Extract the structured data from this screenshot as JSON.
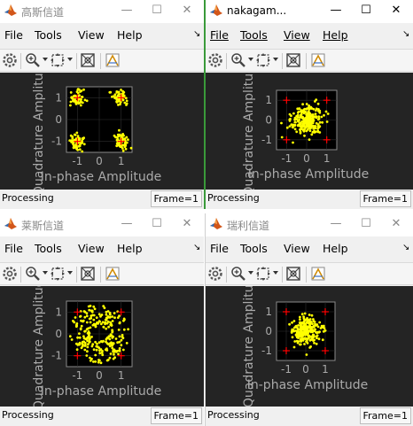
{
  "colors": {
    "window_active_border": "#3a9a3a",
    "plot_bg": "#242424",
    "axes_bg": "#000000",
    "points": "#ffff00",
    "reference": "#ff0000"
  },
  "windows": [
    {
      "title": "高斯信道",
      "active": false
    },
    {
      "title": "nakagam...",
      "active": true
    },
    {
      "title": "莱斯信道",
      "active": false
    },
    {
      "title": "瑞利信道",
      "active": false
    }
  ],
  "title_buttons": {
    "minimize": "—",
    "maximize": "☐",
    "close": "✕"
  },
  "menu": {
    "file": "File",
    "tools": "Tools",
    "view": "View",
    "help": "Help",
    "more": "↘"
  },
  "toolbar_icons": [
    "gear-icon",
    "zoom-in-icon",
    "dropdown-arrow-icon",
    "fit-to-view-icon",
    "dropdown-arrow-icon",
    "autoscale-icon",
    "highlight-icon"
  ],
  "status": {
    "processing": "Processing",
    "frame": "Frame=1"
  },
  "chart_data": [
    {
      "type": "scatter",
      "window": "高斯信道",
      "xlabel": "In-phase Amplitude",
      "ylabel": "Quadrature Amplitude",
      "xticks": [
        "-1",
        "0",
        "1"
      ],
      "yticks": [
        "1",
        "0",
        "-1"
      ],
      "xlim": [
        -1.5,
        1.5
      ],
      "ylim": [
        -1.5,
        1.5
      ],
      "reference_points": [
        [
          -1,
          1
        ],
        [
          1,
          1
        ],
        [
          -1,
          -1
        ],
        [
          1,
          -1
        ]
      ],
      "distribution": "four tight clusters around the ±1 constellation points"
    },
    {
      "type": "scatter",
      "window": "nakagam...",
      "xlabel": "In-phase Amplitude",
      "ylabel": "Quadrature Amplitude",
      "xticks": [
        "-1",
        "0",
        "1"
      ],
      "yticks": [
        "1",
        "0",
        "-1"
      ],
      "xlim": [
        -1.5,
        1.5
      ],
      "ylim": [
        -1.5,
        1.5
      ],
      "reference_points": [
        [
          -1,
          1
        ],
        [
          1,
          1
        ],
        [
          -1,
          -1
        ],
        [
          1,
          -1
        ]
      ],
      "distribution": "dense cloud around the origin"
    },
    {
      "type": "scatter",
      "window": "莱斯信道",
      "xlabel": "In-phase Amplitude",
      "ylabel": "Quadrature Amplitude",
      "xticks": [
        "-1",
        "0",
        "1"
      ],
      "yticks": [
        "1",
        "0",
        "-1"
      ],
      "xlim": [
        -1.5,
        1.5
      ],
      "ylim": [
        -1.5,
        1.5
      ],
      "reference_points": [
        [
          -1,
          1
        ],
        [
          1,
          1
        ],
        [
          -1,
          -1
        ],
        [
          1,
          -1
        ]
      ],
      "distribution": "rotated spread along diagonal directions"
    },
    {
      "type": "scatter",
      "window": "瑞利信道",
      "xlabel": "In-phase Amplitude",
      "ylabel": "Quadrature Amplitude",
      "xticks": [
        "-1",
        "0",
        "1"
      ],
      "yticks": [
        "1",
        "0",
        "-1"
      ],
      "xlim": [
        -1.5,
        1.5
      ],
      "ylim": [
        -1.5,
        1.5
      ],
      "reference_points": [
        [
          -1,
          1
        ],
        [
          1,
          1
        ],
        [
          -1,
          -1
        ],
        [
          1,
          -1
        ]
      ],
      "distribution": "dense cloud around the origin"
    }
  ]
}
